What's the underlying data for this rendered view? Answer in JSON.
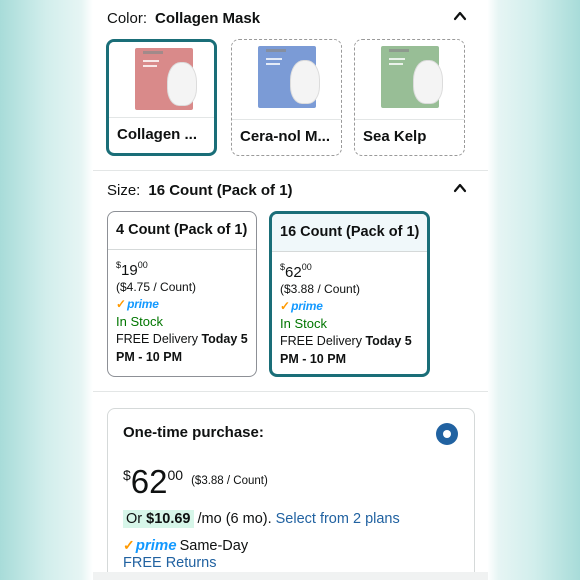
{
  "color_row": {
    "label": "Color:",
    "value": "Collagen Mask",
    "options": [
      {
        "name": "Collagen ...",
        "swatch": "#d98a8a"
      },
      {
        "name": "Cera-nol M...",
        "swatch": "#7b9bd6"
      },
      {
        "name": "Sea Kelp",
        "swatch": "#98be96"
      }
    ]
  },
  "size_row": {
    "label": "Size:",
    "value": "16 Count (Pack of 1)",
    "options": [
      {
        "title": "4 Count (Pack of 1)",
        "currency": "$",
        "whole": "19",
        "fraction": "00",
        "unit_price": "($4.75 / Count)",
        "prime": "prime",
        "stock": "In Stock",
        "delivery_prefix": "FREE Delivery",
        "delivery_bold": "Today 5 PM - 10 PM"
      },
      {
        "title": "16 Count (Pack of 1)",
        "currency": "$",
        "whole": "62",
        "fraction": "00",
        "unit_price": "($3.88 / Count)",
        "prime": "prime",
        "stock": "In Stock",
        "delivery_prefix": "FREE Delivery",
        "delivery_bold": "Today 5 PM - 10 PM"
      }
    ]
  },
  "purchase": {
    "title": "One-time purchase:",
    "currency": "$",
    "whole": "62",
    "fraction": "00",
    "unit_price": "($3.88 / Count)",
    "monthly_or": "Or",
    "monthly_amount": "$10.69",
    "monthly_suffix": "/mo (6 mo).",
    "plans_link": "Select from 2 plans",
    "prime": "prime",
    "same_day": "Same-Day",
    "free_returns": "FREE Returns"
  },
  "colors": {
    "selected_border": "#1a6e78",
    "prime_blue": "#1399ff",
    "link_blue": "#2162a1",
    "in_stock": "#007600"
  }
}
